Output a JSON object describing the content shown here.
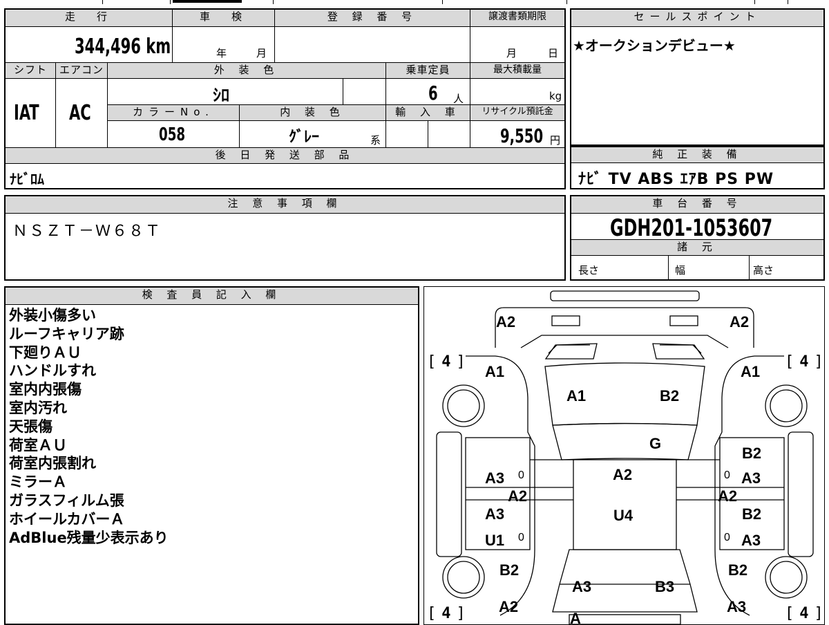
{
  "header": {
    "mileage_label": "走　行",
    "mileage_value": "344,496 km",
    "inspection_label": "車　検",
    "inspection_year": "年",
    "inspection_month": "月",
    "registration_label": "登 録 番 号",
    "deadline_label": "譲渡書類期限",
    "deadline_month": "月",
    "deadline_day": "日",
    "selling_point_label": "セールスポイント",
    "selling_point_value": "★オークションデビュー★"
  },
  "specs": {
    "shift_label": "シフト",
    "shift_value": "IAT",
    "ac_label": "エアコン",
    "ac_value": "AC",
    "exterior_color_label": "外 装 色",
    "exterior_color_value": "ｼﾛ",
    "capacity_label": "乗車定員",
    "capacity_value": "6",
    "capacity_unit": "人",
    "max_load_label": "最大積載量",
    "max_load_unit": "kg",
    "color_no_label": "カラーNo.",
    "color_no_value": "058",
    "interior_color_label": "内 装 色",
    "interior_color_value": "ｸﾞﾚｰ",
    "interior_color_suffix": "系",
    "import_label": "輸 入 車",
    "recycle_label": "リサイクル預託金",
    "recycle_value": "9,550",
    "recycle_unit": "円"
  },
  "later_parts": {
    "label": "後 日 発 送 部 品",
    "value": "ﾅﾋﾞﾛﾑ"
  },
  "equipment": {
    "label": "純 正 装 備",
    "value": "ﾅﾋﾞ TV ABS ｴｱB PS PW"
  },
  "notes": {
    "label": "注 意 事 項 欄",
    "value": "ＮＳＺＴ－Ｗ６８Ｔ"
  },
  "chassis": {
    "label": "車 台 番 号",
    "value": "GDH201-1053607",
    "specs_label": "諸 元",
    "length_label": "長さ",
    "width_label": "幅",
    "height_label": "高さ"
  },
  "inspector": {
    "label": "検 査 員 記 入 欄",
    "lines": [
      "外装小傷多い",
      "ルーフキャリア跡",
      "下廻りＡＵ",
      "ハンドルすれ",
      "室内内張傷",
      "室内汚れ",
      "天張傷",
      "荷室ＡＵ",
      "荷室内張割れ",
      "ミラーＡ",
      "ガラスフィルム張",
      "ホイールカバーＡ",
      "AdBlue残量少表示あり"
    ]
  },
  "diagram": {
    "tire_mark": "4",
    "marks": {
      "front_left_corner": "A2",
      "front_right_corner": "A2",
      "left_front_fender": "A1",
      "right_front_fender": "A1",
      "hood_left": "A1",
      "hood_right": "B2",
      "windshield": "G",
      "left_front_door_upper": "A3",
      "right_front_door_upper_top": "B2",
      "right_front_door_upper": "A3",
      "roof_front": "A2",
      "left_pillar": "A2",
      "right_pillar": "A2",
      "left_rear_door_upper": "A3",
      "right_rear_door_upper": "B2",
      "roof_rear": "U4",
      "left_rocker": "U1",
      "right_rocker": "A3",
      "left_rear_fender": "B2",
      "right_rear_fender": "B2",
      "rear_left": "A3",
      "rear_right": "B3",
      "rear_left_corner": "A2",
      "rear_right_corner": "A3",
      "rear_center": "A",
      "zero": "0"
    }
  }
}
